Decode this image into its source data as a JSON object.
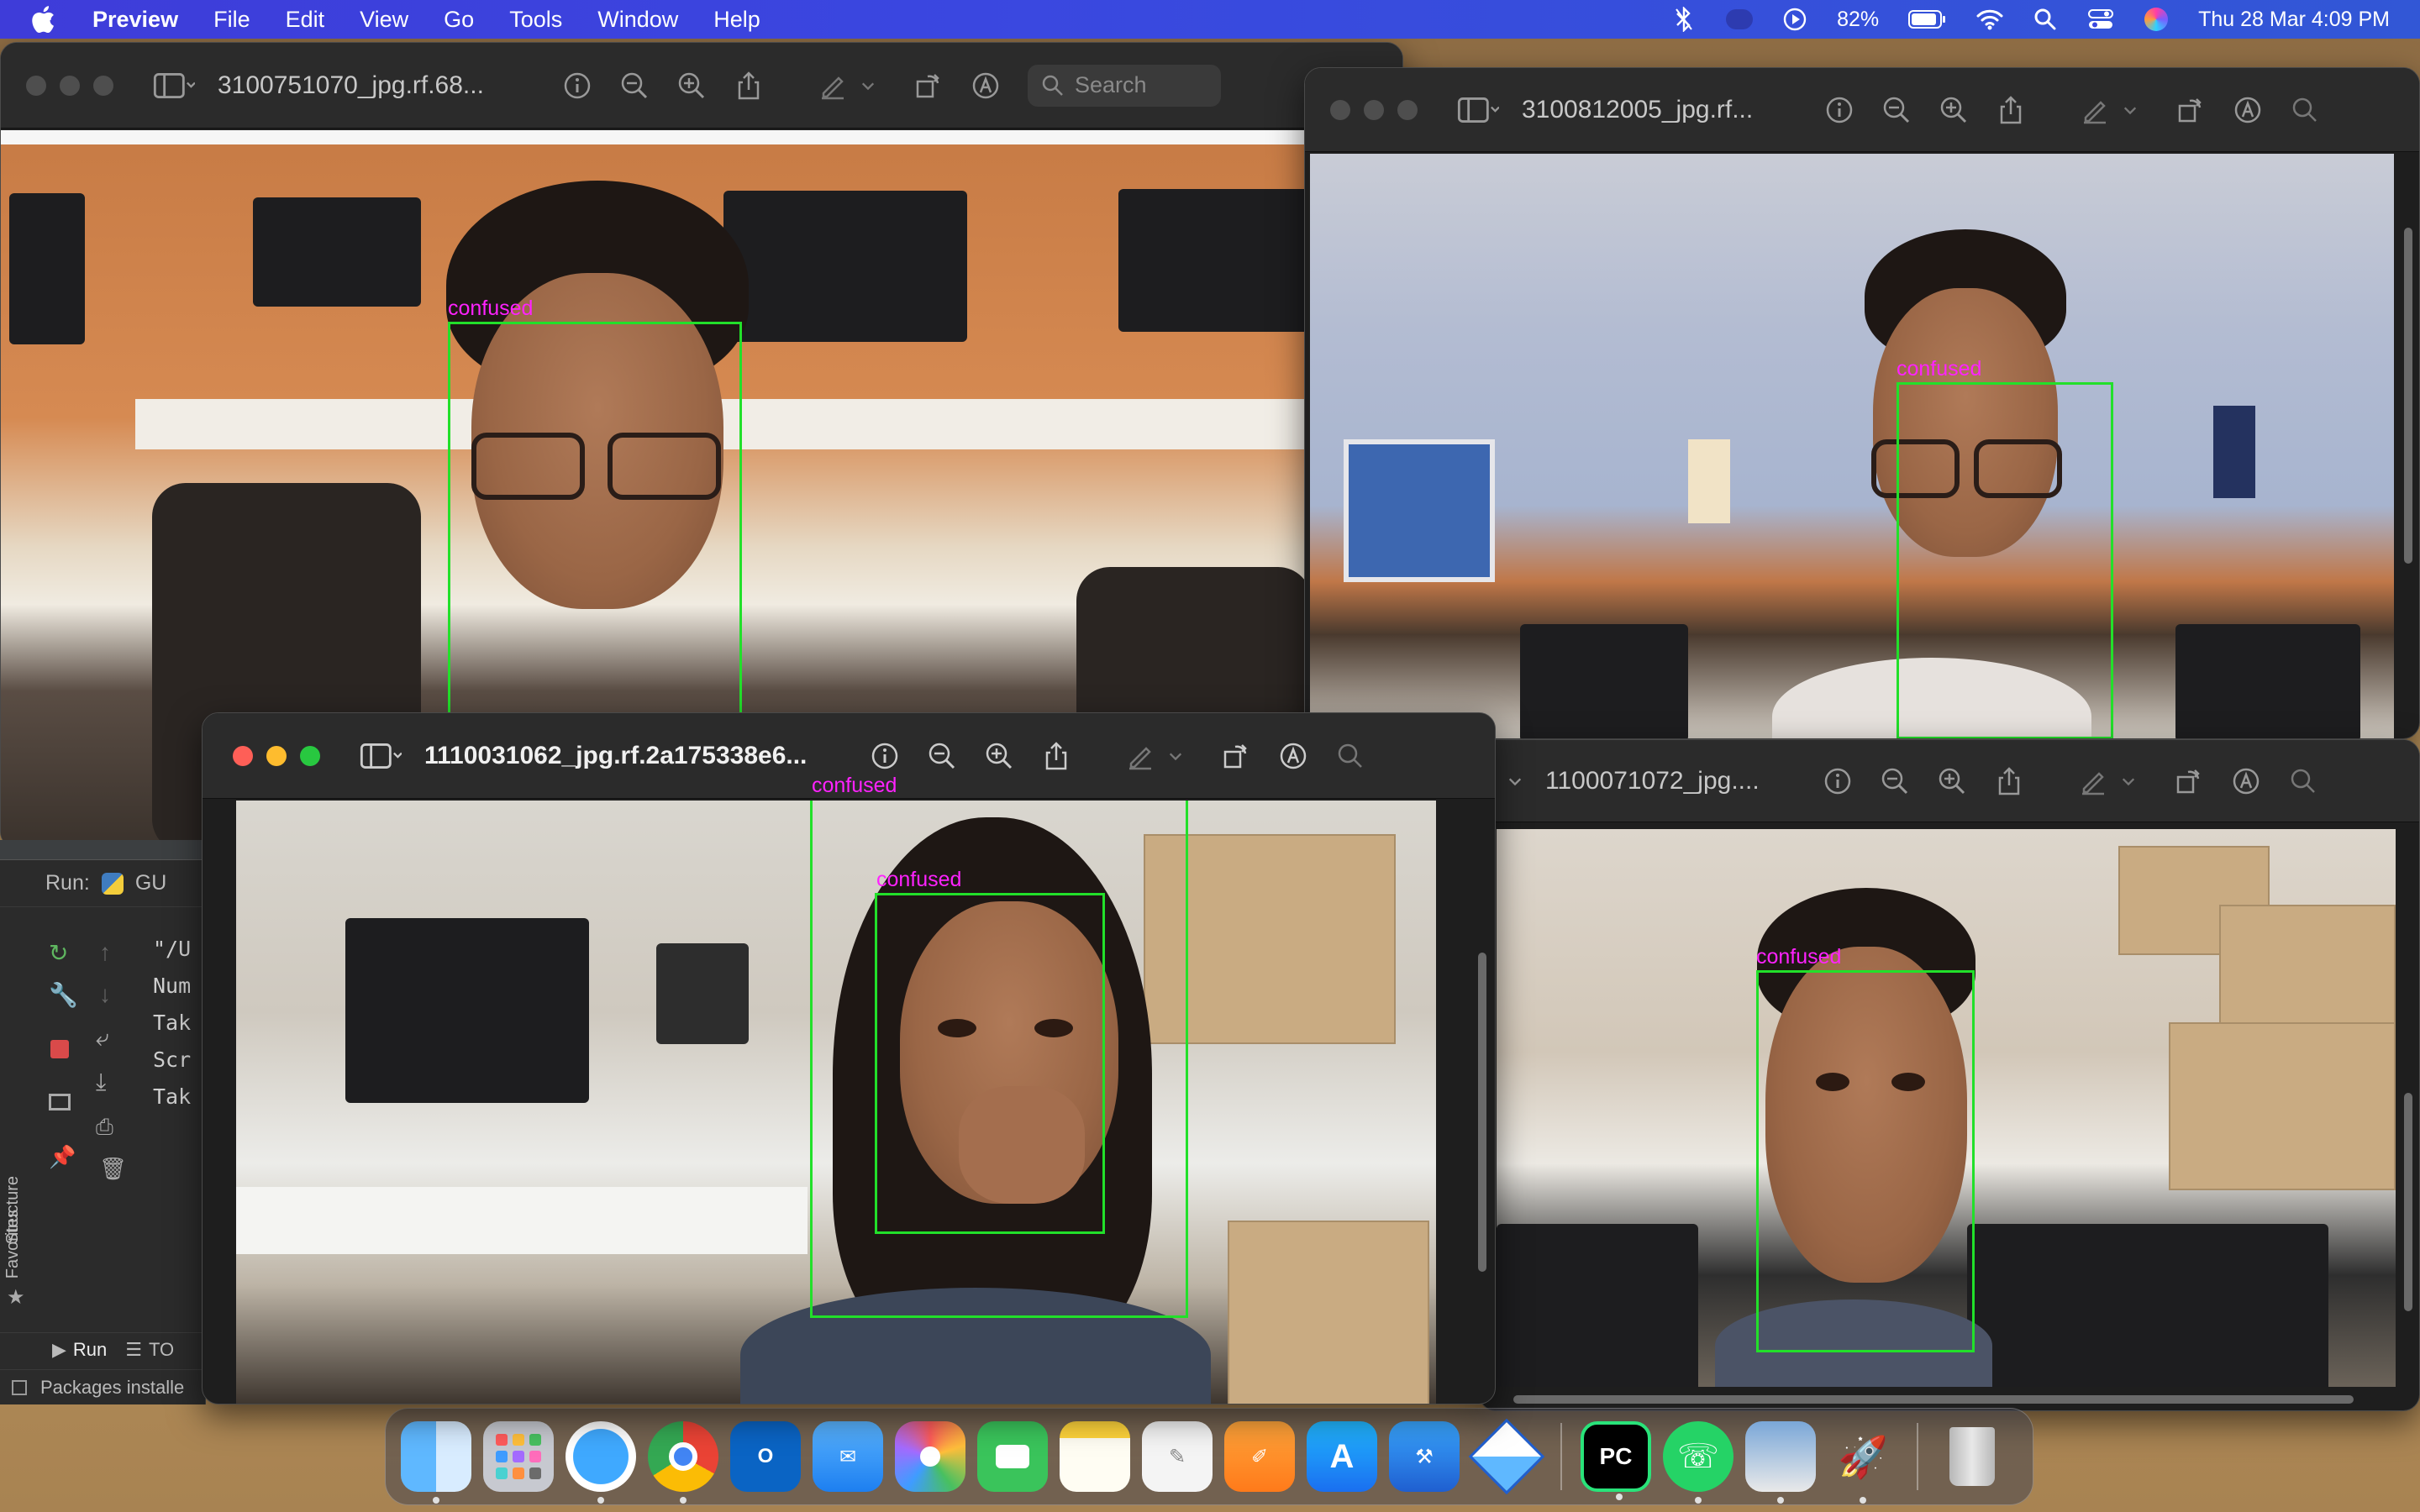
{
  "menubar": {
    "app_name": "Preview",
    "items": [
      "File",
      "Edit",
      "View",
      "Go",
      "Tools",
      "Window",
      "Help"
    ],
    "battery": "82%",
    "clock": "Thu 28 Mar  4:09 PM"
  },
  "windows": {
    "w1": {
      "title": "3100751070_jpg.rf.68...",
      "search_placeholder": "Search",
      "label": "confused"
    },
    "w2": {
      "title": "3100812005_jpg.rf...",
      "label": "confused"
    },
    "w3": {
      "title": "1110031062_jpg.rf.2a175338e6...",
      "labels": [
        "confused",
        "confused"
      ]
    },
    "w4": {
      "title": "1100071072_jpg....",
      "label": "confused"
    }
  },
  "ide": {
    "run_tab": "Run:",
    "run_config": "GU",
    "console_lines": [
      "\"/U",
      "Num",
      "Tak",
      "Scr",
      "Tak"
    ],
    "side_tabs": [
      "Structure",
      "Favorites"
    ],
    "bottom_tabs": [
      "Run",
      "TO"
    ],
    "status": "Packages installe"
  },
  "dock": {
    "apps": [
      "finder-icon",
      "launchpad-icon",
      "safari-icon",
      "chrome-icon",
      "outlook-icon",
      "mail-icon",
      "photos-icon",
      "facetime-icon",
      "notes-icon",
      "textedit-icon",
      "pages-icon",
      "appstore-icon",
      "xcode-icon",
      "box-icon",
      "pycharm-icon",
      "whatsapp-icon",
      "preview-icon",
      "rocket-icon",
      "trash-icon"
    ],
    "pycharm_label": "PC"
  },
  "colors": {
    "detection_box": "#22e02a",
    "detection_label": "#ff22ff",
    "menubar": "#3a47e0"
  }
}
